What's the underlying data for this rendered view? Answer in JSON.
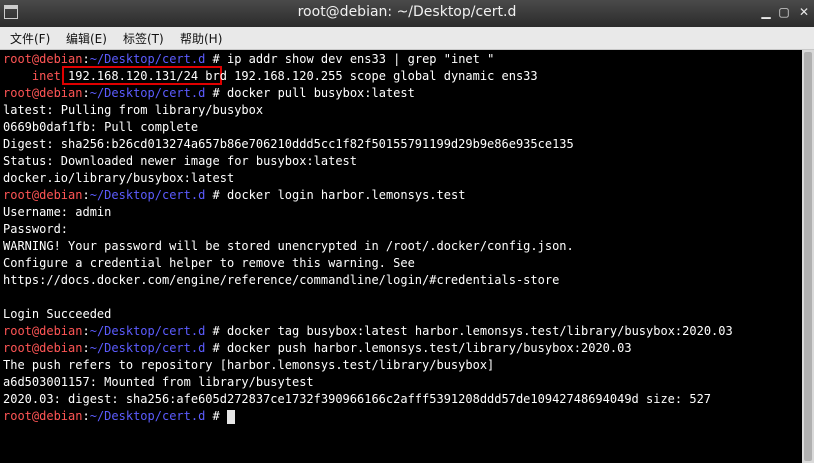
{
  "window": {
    "title": "root@debian: ~/Desktop/cert.d"
  },
  "menu": [
    "文件(F)",
    "编辑(E)",
    "标签(T)",
    "帮助(H)"
  ],
  "prompt": {
    "user": "root@debian",
    "colon": ":",
    "path": "~/Desktop/cert.d",
    "symbol": " # "
  },
  "lines": [
    {
      "prompt": true,
      "cmd": "ip addr show dev ens33 | grep \"inet \""
    },
    {
      "inet_label": "    inet ",
      "ip": "192.168.120.131/24",
      "rest": " brd 192.168.120.255 scope global dynamic ens33"
    },
    {
      "prompt": true,
      "cmd": "docker pull busybox:latest"
    },
    {
      "text": "latest: Pulling from library/busybox"
    },
    {
      "text": "0669b0daf1fb: Pull complete"
    },
    {
      "text": "Digest: sha256:b26cd013274a657b86e706210ddd5cc1f82f50155791199d29b9e86e935ce135"
    },
    {
      "text": "Status: Downloaded newer image for busybox:latest"
    },
    {
      "text": "docker.io/library/busybox:latest"
    },
    {
      "prompt": true,
      "cmd": "docker login harbor.lemonsys.test"
    },
    {
      "text": "Username: admin"
    },
    {
      "text": "Password:"
    },
    {
      "text": "WARNING! Your password will be stored unencrypted in /root/.docker/config.json."
    },
    {
      "text": "Configure a credential helper to remove this warning. See"
    },
    {
      "text": "https://docs.docker.com/engine/reference/commandline/login/#credentials-store"
    },
    {
      "text": ""
    },
    {
      "text": "Login Succeeded"
    },
    {
      "prompt": true,
      "cmd": "docker tag busybox:latest harbor.lemonsys.test/library/busybox:2020.03"
    },
    {
      "prompt": true,
      "cmd": "docker push harbor.lemonsys.test/library/busybox:2020.03"
    },
    {
      "text": "The push refers to repository [harbor.lemonsys.test/library/busybox]"
    },
    {
      "text": "a6d503001157: Mounted from library/busytest"
    },
    {
      "text": "2020.03: digest: sha256:afe605d272837ce1732f390966166c2afff5391208ddd57de10942748694049d size: 527"
    },
    {
      "prompt": true,
      "cmd": "",
      "cursor": true
    }
  ],
  "colors": {
    "prompt_user": "#ff5555",
    "prompt_path": "#5c5cff",
    "highlight": "#e00000"
  }
}
